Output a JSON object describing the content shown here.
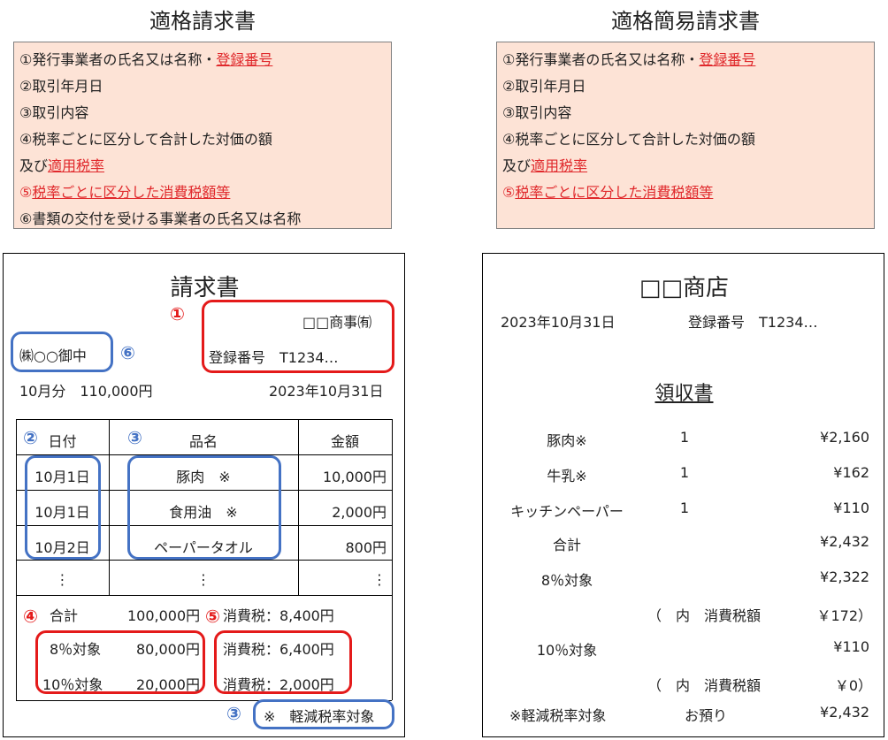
{
  "left_title": "適格請求書",
  "right_title": "適格簡易請求書",
  "left_requirements": [
    {
      "parts": [
        {
          "text": "①発行事業者の氏名又は名称・",
          "red": false
        },
        {
          "text": "登録番号",
          "red": true
        }
      ]
    },
    {
      "parts": [
        {
          "text": "②取引年月日",
          "red": false
        }
      ]
    },
    {
      "parts": [
        {
          "text": "③取引内容",
          "red": false
        }
      ]
    },
    {
      "parts": [
        {
          "text": "④税率ごとに区分して合計した対価の額",
          "red": false
        }
      ]
    },
    {
      "parts": [
        {
          "text": "及び",
          "red": false
        },
        {
          "text": "適用税率",
          "red": true
        }
      ]
    },
    {
      "parts": [
        {
          "text": "⑤",
          "red": false,
          "color": "red"
        },
        {
          "text": "税率ごとに区分した消費税額等",
          "red": true
        }
      ]
    },
    {
      "parts": [
        {
          "text": "⑥書類の交付を受ける事業者の氏名又は名称",
          "red": false
        }
      ]
    }
  ],
  "right_requirements": [
    {
      "parts": [
        {
          "text": "①発行事業者の氏名又は名称・",
          "red": false
        },
        {
          "text": "登録番号",
          "red": true
        }
      ]
    },
    {
      "parts": [
        {
          "text": "②取引年月日",
          "red": false
        }
      ]
    },
    {
      "parts": [
        {
          "text": "③取引内容",
          "red": false
        }
      ]
    },
    {
      "parts": [
        {
          "text": "④税率ごとに区分して合計した対価の額",
          "red": false
        }
      ]
    },
    {
      "parts": [
        {
          "text": "及び",
          "red": false
        },
        {
          "text": "適用税率",
          "red": true
        }
      ]
    },
    {
      "parts": [
        {
          "text": "⑤",
          "red": false,
          "color": "red"
        },
        {
          "text": "税率ごとに区分した消費税額等",
          "red": true
        }
      ]
    }
  ],
  "invoice": {
    "title": "請求書",
    "issuer": "□□商事㈲",
    "reg_label": "登録番号　T1234…",
    "recipient": "㈱○○御中",
    "period_amount": "10月分　110,000円",
    "date": "2023年10月31日",
    "headers": [
      "日付",
      "品名",
      "金額"
    ],
    "rows": [
      {
        "date": "10月1日",
        "item": "豚肉　※",
        "amount": "10,000円"
      },
      {
        "date": "10月1日",
        "item": "食用油　※",
        "amount": "2,000円"
      },
      {
        "date": "10月2日",
        "item": "ペーパータオル",
        "amount": "800円"
      },
      {
        "date": "⋮",
        "item": "⋮",
        "amount": "⋮"
      }
    ],
    "total_label": "合計",
    "total_amount": "100,000円",
    "total_tax": "消費税：8,400円",
    "rate8_label": "8％対象",
    "rate8_amount": "80,000円",
    "rate8_tax": "消費税：6,400円",
    "rate10_label": "10％対象",
    "rate10_amount": "20,000円",
    "rate10_tax": "消費税：2,000円",
    "reduced_note": "※　軽減税率対象",
    "markers": {
      "m1": "①",
      "m2": "②",
      "m3": "③",
      "m3b": "③",
      "m4": "④",
      "m5": "⑤",
      "m6": "⑥"
    }
  },
  "receipt": {
    "shop": "□□商店",
    "date": "2023年10月31日",
    "reg": "登録番号　T1234…",
    "title": "領収書",
    "items": [
      {
        "name": "豚肉※",
        "qty": "1",
        "price": "¥2,160"
      },
      {
        "name": "牛乳※",
        "qty": "1",
        "price": "¥162"
      },
      {
        "name": "キッチンペーパー",
        "qty": "1",
        "price": "¥110"
      }
    ],
    "total_label": "合計",
    "total": "¥2,432",
    "rate8_label": "8％対象",
    "rate8": "¥2,322",
    "tax8_open": "（　内　消費税額",
    "tax8_value": "￥172）",
    "rate10_label": "10％対象",
    "rate10": "¥110",
    "tax10_open": "（　内　消費税額",
    "tax10_value": "￥0）",
    "note": "※軽減税率対象",
    "received_label": "お預り",
    "received": "¥2,432"
  }
}
